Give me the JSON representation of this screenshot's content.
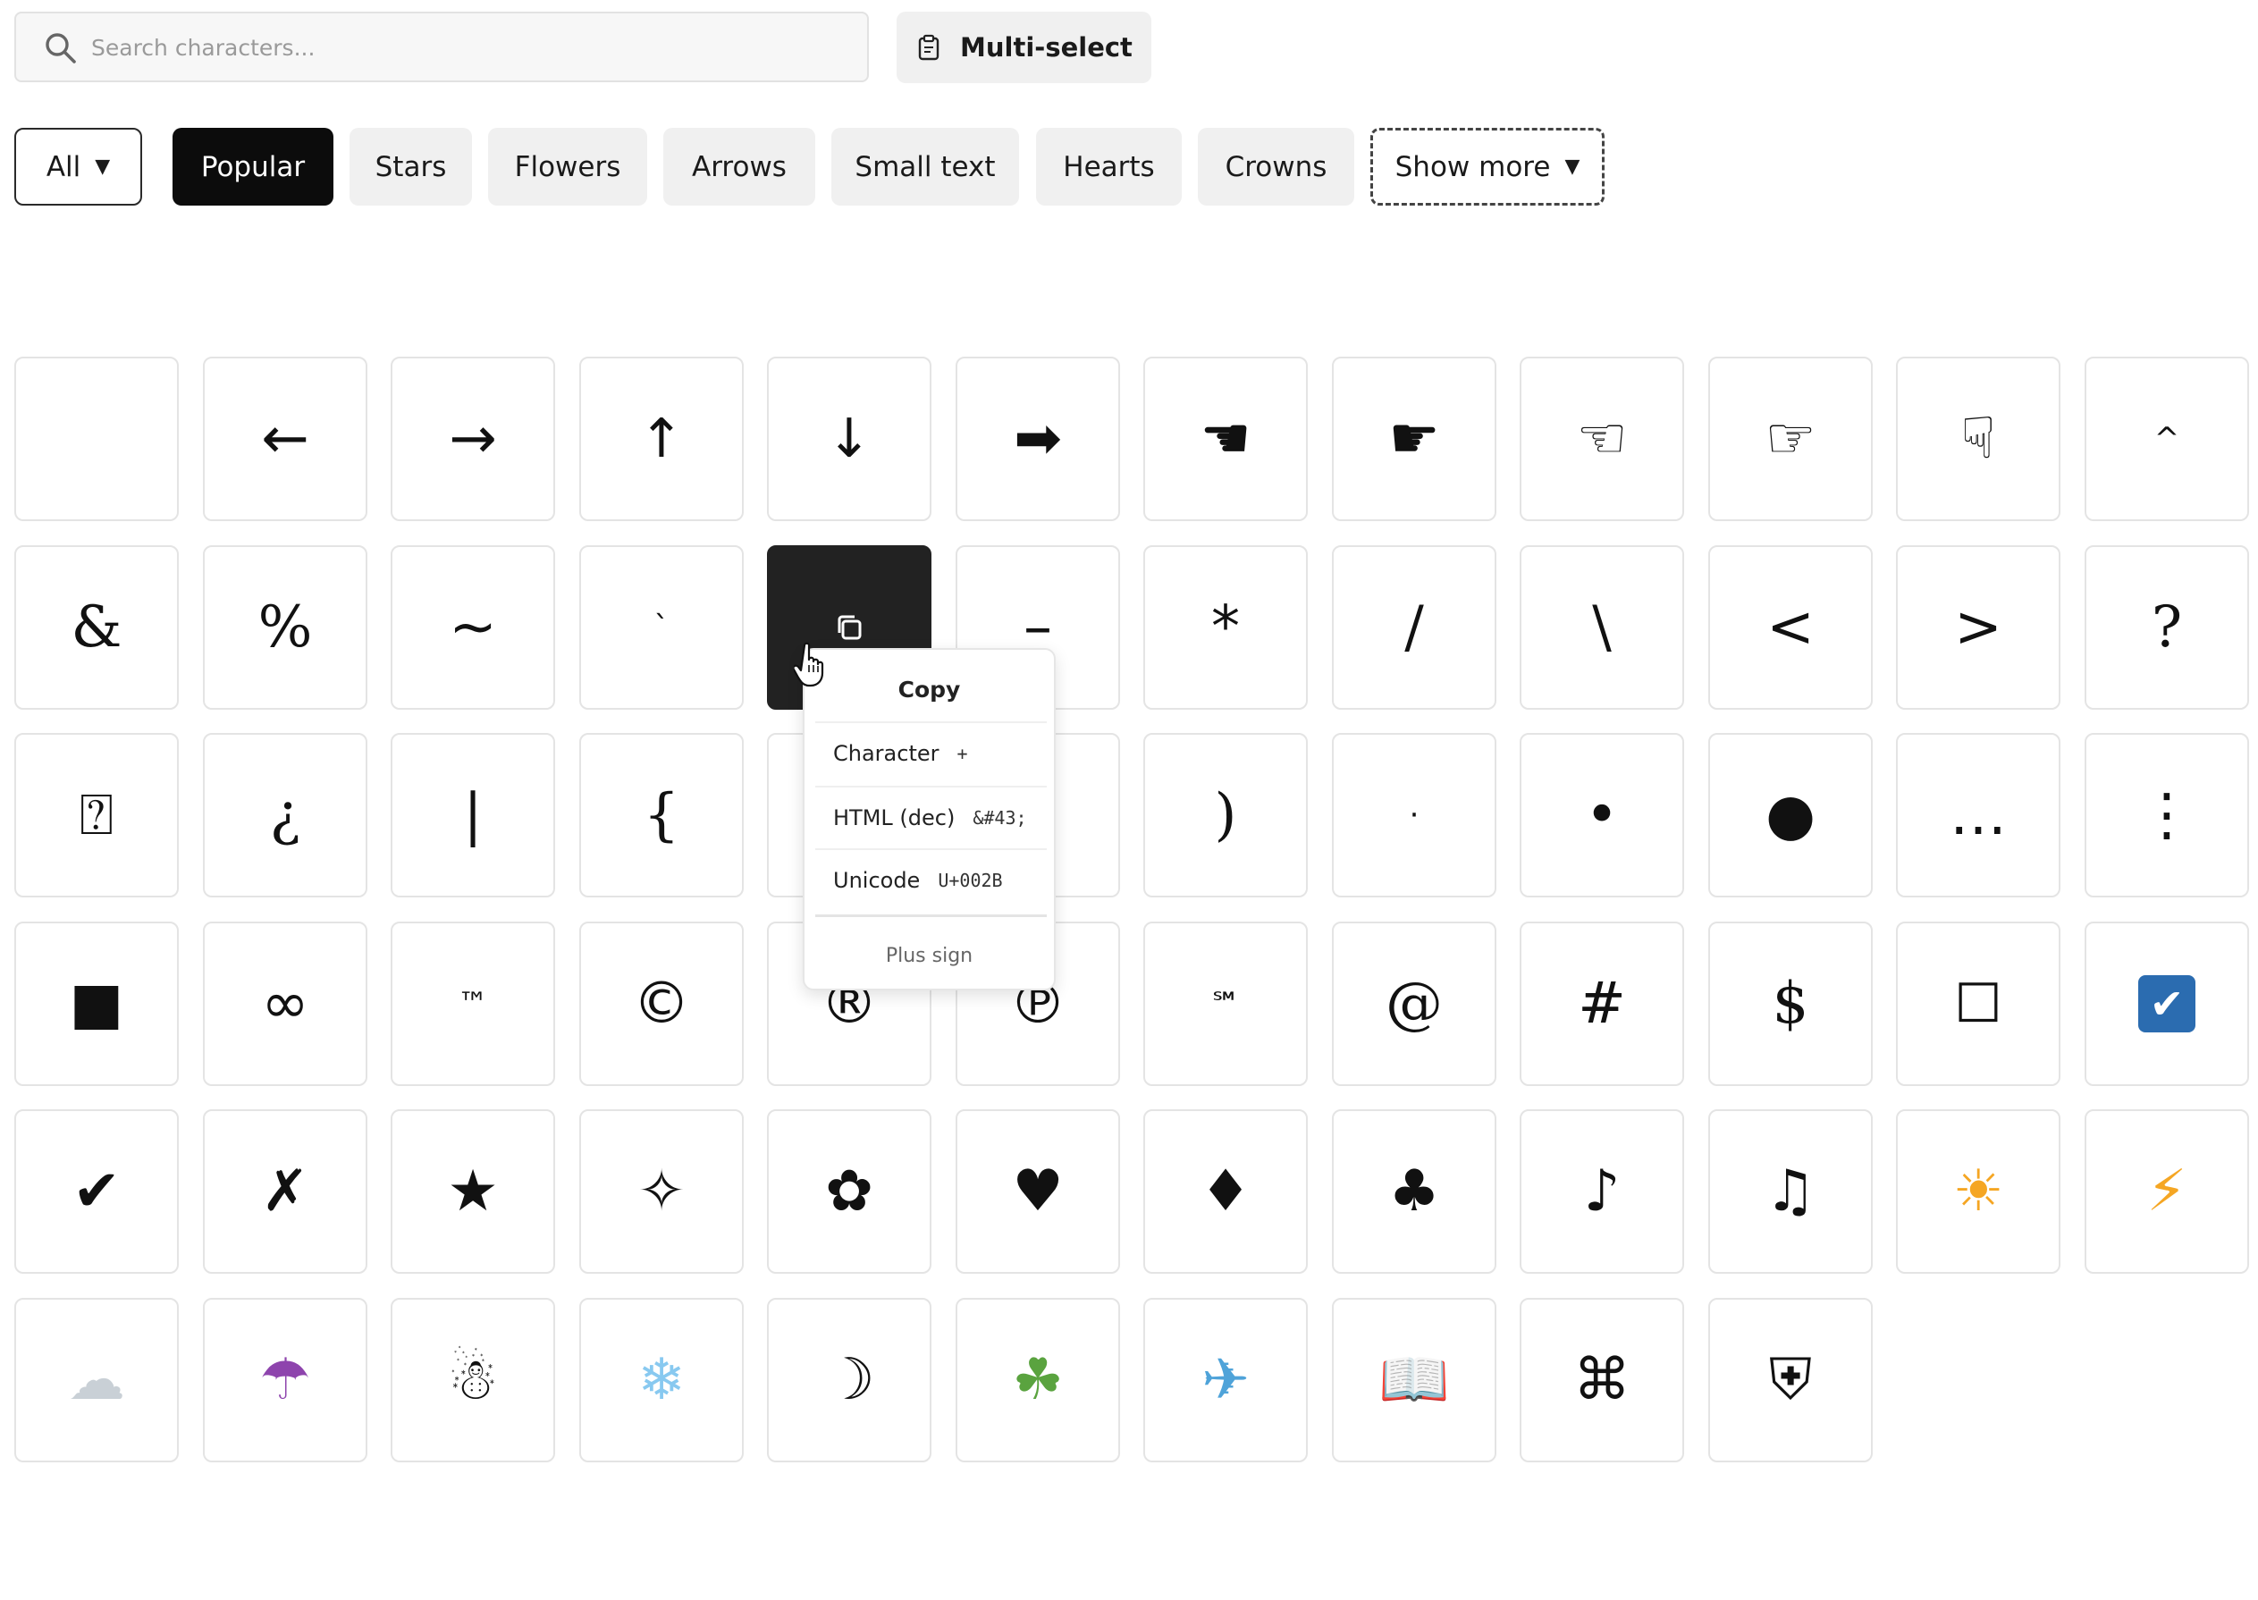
{
  "search": {
    "placeholder": "Search characters..."
  },
  "toolbar": {
    "multiselect_label": "Multi-select"
  },
  "filters": {
    "all_label": "All",
    "chips": [
      "Popular",
      "Stars",
      "Flowers",
      "Arrows",
      "Small text",
      "Hearts",
      "Crowns"
    ],
    "show_more_label": "Show more",
    "dropdown_glyph": "▼"
  },
  "grid": {
    "rows": [
      [
        " ",
        "←",
        "→",
        "↑",
        "↓",
        "➡",
        "☚",
        "☛",
        "☜",
        "☞",
        "☟",
        "^"
      ],
      [
        "&",
        "%",
        "~",
        "`",
        "+",
        "–",
        "*",
        "/",
        "\\",
        "<",
        ">",
        "?"
      ],
      [
        "⍰",
        "¿",
        "|",
        "{",
        "}",
        "(",
        ")",
        "·",
        "•",
        "●",
        "…",
        "⋮"
      ],
      [
        "■",
        "∞",
        "™",
        "©",
        "®",
        "℗",
        "℠",
        "@",
        "#",
        "$",
        "☐",
        "☑"
      ],
      [
        "✔",
        "✗",
        "★",
        "✧",
        "✿",
        "♥",
        "♦",
        "♣",
        "♪",
        "♫",
        "☀",
        "⚡"
      ],
      [
        "☁",
        "☂",
        "☃",
        "❄",
        "☽",
        "☘",
        "✈",
        "📖",
        "⌘",
        "⛨"
      ]
    ],
    "active_icon": "copy-icon"
  },
  "popover": {
    "title": "Copy",
    "rows": [
      {
        "label": "Character",
        "value": "+"
      },
      {
        "label": "HTML (dec)",
        "value": "&#43;"
      },
      {
        "label": "Unicode",
        "value": "U+002B"
      }
    ],
    "footer": "Plus sign"
  },
  "colors": {
    "chip_bg": "#f0f0f0",
    "active_chip": "#0c0c0c",
    "active_tile": "#222222",
    "sun": "#f5a623",
    "bolt": "#f5a623",
    "cloud": "#c9d0d6",
    "umbrella": "#8e44ad",
    "snowflake": "#88c9f0",
    "shamrock": "#5aa33f",
    "plane": "#4fa3d9",
    "checkbox": "#2b6cb0"
  }
}
